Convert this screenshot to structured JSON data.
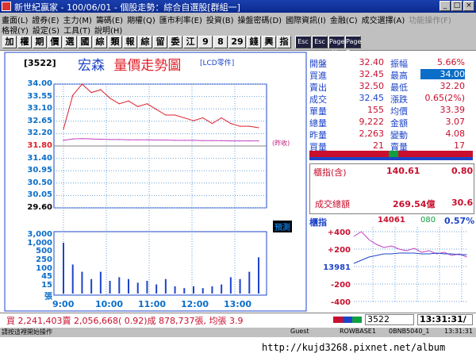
{
  "window": {
    "title": "新世紀贏家 - 100/06/01 - 個股走勢：綜合自選股[群組一]"
  },
  "menu": {
    "row1": [
      "畫面(L)",
      "證券(E)",
      "主力(M)",
      "籌碼(E)",
      "期權(Q)",
      "匯市利率(E)",
      "投資(B)",
      "操盤密碼(D)",
      "國際資訊(I)",
      "金融(C)",
      "成交選擇(A)"
    ],
    "row1_disabled": "功能操作(F)",
    "row2": [
      "格視(Y)",
      "設定(S)",
      "工具(T)",
      "說明(H)"
    ]
  },
  "toolbar": {
    "buttons": [
      "加",
      "權",
      "期",
      "價",
      "選",
      "國",
      "綜",
      "類",
      "報",
      "綜",
      "留",
      "委",
      "江",
      "9",
      "8",
      "29",
      "錢",
      "興",
      "指"
    ],
    "dark_buttons": [
      "Esc",
      "Esc",
      "Page Up",
      "Page Down"
    ]
  },
  "chart_header": {
    "code": "[3522]",
    "name": "宏森",
    "title": "量價走勢圖",
    "subtitle": "[LCD零件]"
  },
  "price_axis": {
    "ticks": [
      "34.00",
      "33.55",
      "33.10",
      "32.65",
      "32.20",
      "31.80",
      "31.40",
      "30.95",
      "30.50",
      "30.05",
      "29.60"
    ],
    "ref_label": "(昨收)",
    "flag_label": "預測"
  },
  "volume_axis": {
    "ticks": [
      "3,000",
      "1,000",
      "500",
      "250",
      "100",
      "45",
      "15"
    ],
    "unit": "張"
  },
  "time_axis": [
    "9:00",
    "10:00",
    "11:00",
    "12:00",
    "13:00"
  ],
  "quote": {
    "rows": [
      {
        "l1": "開盤",
        "v1": "32.40",
        "l2": "振幅",
        "v2": "5.66%"
      },
      {
        "l1": "買進",
        "v1": "32.45",
        "l2": "最高",
        "v2": "34.00"
      },
      {
        "l1": "賣出",
        "v1": "32.50",
        "l2": "最低",
        "v2": "32.20"
      },
      {
        "l1": "成交",
        "v1": "32.45",
        "l2": "漲跌",
        "v2": "0.65(2%)"
      },
      {
        "l1": "單量",
        "v1": "155",
        "l2": "均價",
        "v2": "33.39"
      },
      {
        "l1": "總量",
        "v1": "9,222",
        "l2": "金額",
        "v2": "3.07"
      },
      {
        "l1": "昨量",
        "v1": "2,263",
        "l2": "變動",
        "v2": "4.08"
      },
      {
        "l1": "買量",
        "v1": "21",
        "l2": "賣量",
        "v2": "17"
      }
    ]
  },
  "index_box": {
    "label": "櫃指(含)",
    "value": "140.61",
    "change": "0.80",
    "turnover_label": "成交總額",
    "turnover": "269.54億",
    "turnover_change": "30.6"
  },
  "mini_chart": {
    "label": "櫃指",
    "value": "14061",
    "change": "080",
    "pct": "0.57%",
    "y_ticks": [
      "+400",
      "+200",
      "13981",
      "-200",
      "-400"
    ]
  },
  "status": {
    "summary": "買 2,241,403賣 2,056,668( 0.92)成 878,737張, 均張 3.9",
    "code_input": "3522",
    "time": "13:31:31/"
  },
  "lower_bar": {
    "left": "請按這裡開始操作",
    "guest": "Guest",
    "server": "ROWBASE1",
    "conn": "0BNB5040_1",
    "clock": "13:31:31"
  },
  "watermark": "http://kujd3268.pixnet.net/album",
  "chart_data": {
    "type": "line",
    "title": "量價走勢圖",
    "x": [
      "9:00",
      "9:05",
      "9:10",
      "9:15",
      "9:20",
      "9:30",
      "9:45",
      "10:00",
      "10:15",
      "10:30",
      "10:45",
      "11:00",
      "11:15",
      "11:30",
      "11:45",
      "12:00",
      "12:15",
      "12:30",
      "12:45",
      "13:00",
      "13:15",
      "13:30"
    ],
    "series": [
      {
        "values": [
          32.4,
          33.6,
          34.0,
          33.7,
          33.8,
          33.5,
          33.3,
          33.4,
          33.2,
          33.3,
          33.1,
          32.9,
          32.9,
          32.8,
          32.7,
          32.8,
          32.6,
          32.8,
          32.6,
          32.5,
          32.5,
          32.45
        ]
      },
      {
        "values": [
          32.0,
          32.05,
          32.06,
          32.05,
          32.04,
          32.03,
          32.03,
          32.02,
          32.02,
          32.02,
          32.01,
          32.01,
          32.0,
          32.0,
          32.0,
          31.99,
          31.99,
          31.99,
          31.98,
          31.98,
          31.98,
          31.98
        ]
      }
    ],
    "ylim": [
      29.6,
      34.0
    ],
    "reference": 31.8,
    "volume": [
      140,
      80,
      60,
      40,
      60,
      35,
      45,
      40,
      30,
      35,
      25,
      40,
      20,
      15,
      20,
      15,
      20,
      25,
      45,
      40,
      60,
      100
    ]
  }
}
